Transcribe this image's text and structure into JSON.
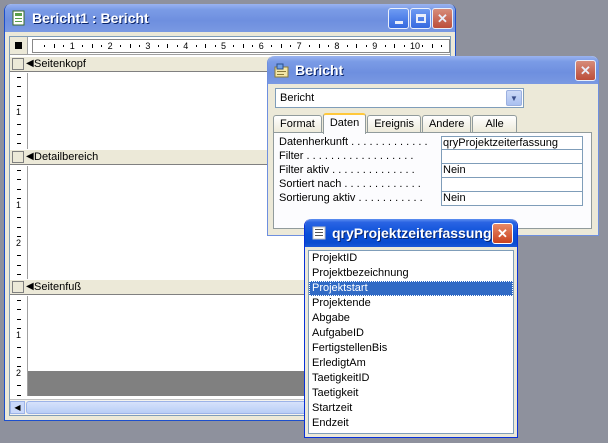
{
  "report_window": {
    "title": "Bericht1 : Bericht",
    "ruler_numbers": [
      "1",
      "2",
      "3",
      "4",
      "5",
      "6",
      "7",
      "8",
      "9",
      "10"
    ],
    "vruler_numbers": [
      "1",
      "2"
    ],
    "sections": {
      "header": "Seitenkopf",
      "detail": "Detailbereich",
      "footer": "Seitenfuß"
    }
  },
  "properties_window": {
    "title": "Bericht",
    "object_select": "Bericht",
    "tabs": [
      "Format",
      "Daten",
      "Ereignis",
      "Andere",
      "Alle"
    ],
    "active_tab": "Daten",
    "rows": [
      {
        "label": "Datenherkunft . . . . . . . . . . . . .",
        "value": "qryProjektzeiterfassung"
      },
      {
        "label": "Filter . . . . . . . . . . . . . . . . . .",
        "value": ""
      },
      {
        "label": "Filter aktiv . . . . . . . . . . . . . .",
        "value": "Nein"
      },
      {
        "label": "Sortiert nach . . . . . . . . . . . . .",
        "value": ""
      },
      {
        "label": "Sortierung aktiv . . . . . . . . . . .",
        "value": "Nein"
      }
    ]
  },
  "field_list": {
    "title": "qryProjektzeiterfassung",
    "selected": "Projektstart",
    "fields": [
      "ProjektID",
      "Projektbezeichnung",
      "Projektstart",
      "Projektende",
      "Abgabe",
      "AufgabeID",
      "FertigstellenBis",
      "ErledigtAm",
      "TaetigkeitID",
      "Taetigkeit",
      "Startzeit",
      "Endzeit"
    ]
  },
  "icons": {
    "minimize": "minimize-icon",
    "maximize": "maximize-icon",
    "close": "close-icon",
    "dropdown": "chevron-down-icon"
  }
}
